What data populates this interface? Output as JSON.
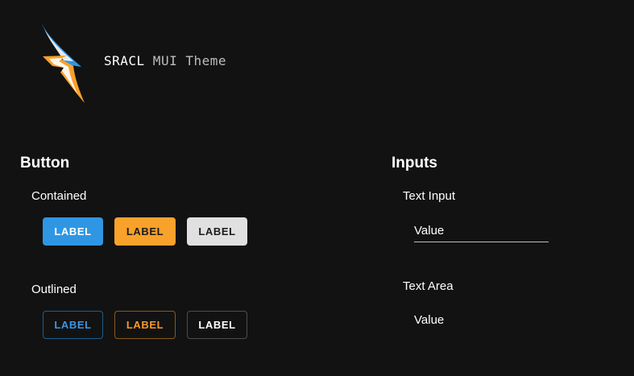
{
  "brand": {
    "name_bold": "SRACL",
    "name_rest": " MUI Theme"
  },
  "colors": {
    "background": "#121212",
    "primary": "#2f96e4",
    "secondary": "#f8a12b",
    "neutral": "#e0e0e0"
  },
  "buttons_section": {
    "title": "Button",
    "contained": {
      "title": "Contained",
      "items": [
        {
          "label": "LABEL",
          "color": "primary"
        },
        {
          "label": "LABEL",
          "color": "secondary"
        },
        {
          "label": "LABEL",
          "color": "neutral"
        }
      ]
    },
    "outlined": {
      "title": "Outlined",
      "items": [
        {
          "label": "LABEL",
          "color": "primary"
        },
        {
          "label": "LABEL",
          "color": "secondary"
        },
        {
          "label": "LABEL",
          "color": "neutral"
        }
      ]
    }
  },
  "inputs_section": {
    "title": "Inputs",
    "text_input": {
      "title": "Text Input",
      "value": "Value"
    },
    "text_area": {
      "title": "Text Area",
      "value": "Value"
    }
  },
  "icons": {
    "logo": "lightning-bolt-logo-icon"
  }
}
